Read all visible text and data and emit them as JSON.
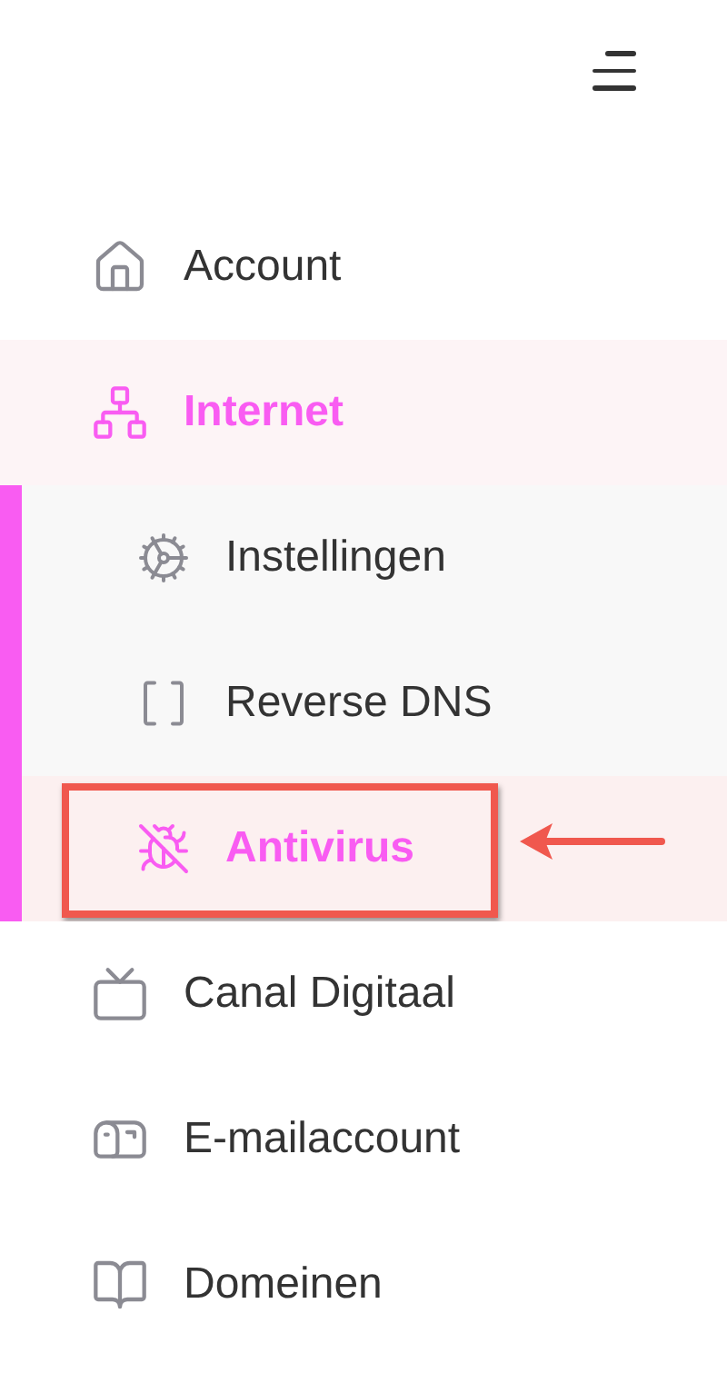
{
  "nav": [
    {
      "label": "Account",
      "selected": false
    },
    {
      "label": "Internet",
      "selected": true,
      "expanded": true,
      "children": [
        {
          "label": "Instellingen",
          "selected": false,
          "highlighted": false
        },
        {
          "label": "Reverse DNS",
          "selected": false,
          "highlighted": false
        },
        {
          "label": "Antivirus",
          "selected": true,
          "highlighted": true
        }
      ]
    },
    {
      "label": "Canal Digitaal",
      "selected": false
    },
    {
      "label": "E-mailaccount",
      "selected": false
    },
    {
      "label": "Domeinen",
      "selected": false
    }
  ]
}
